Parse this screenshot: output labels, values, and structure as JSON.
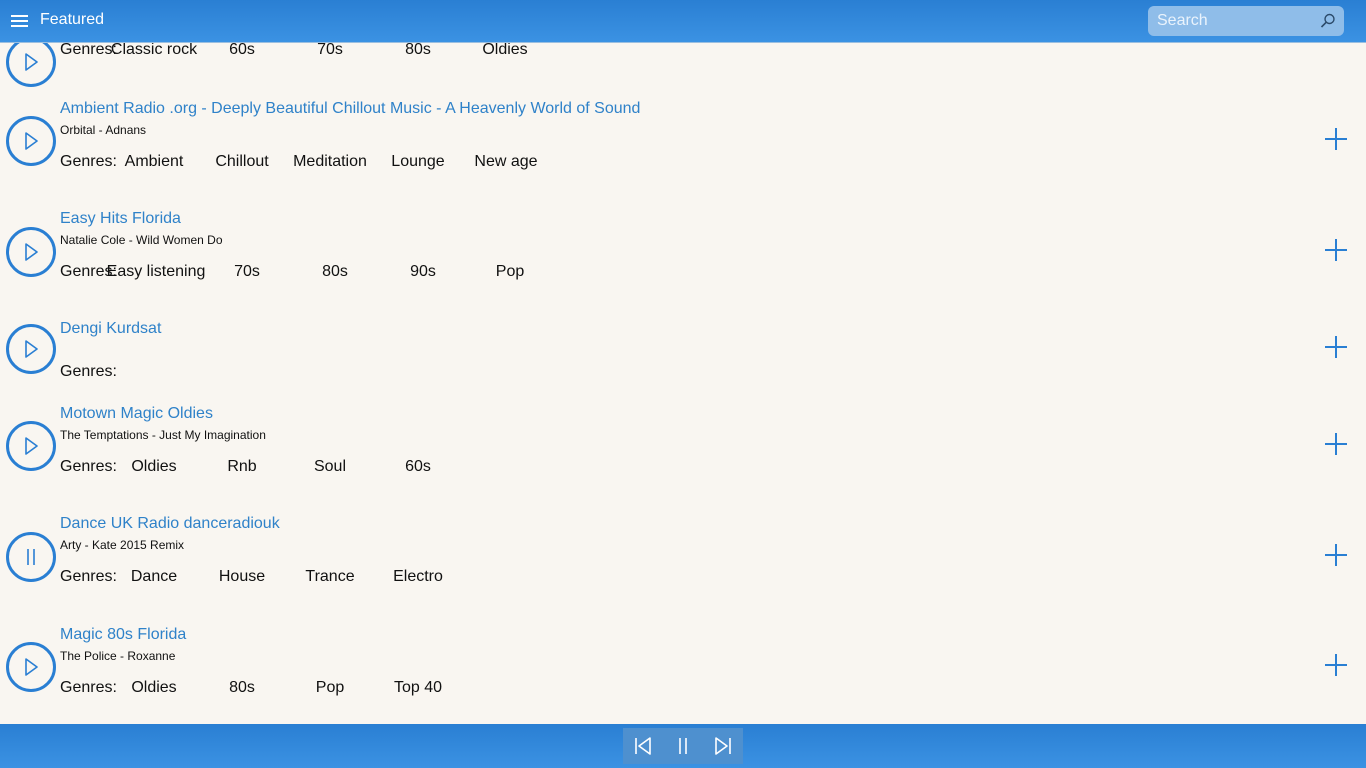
{
  "header": {
    "title": "Featured",
    "search_placeholder": "Search",
    "menu_icon": "hamburger-icon",
    "search_icon": "search-icon"
  },
  "genres_label": "Genres:",
  "stations": [
    {
      "name": "",
      "now_playing": "",
      "state": "play",
      "genres": [
        "Classic rock",
        "60s",
        "70s",
        "80s",
        "Oldies"
      ]
    },
    {
      "name": "Ambient Radio .org - Deeply Beautiful Chillout Music - A Heavenly World of Sound",
      "now_playing": "Orbital - Adnans",
      "state": "play",
      "genres": [
        "Ambient",
        "Chillout",
        "Meditation",
        "Lounge",
        "New age"
      ]
    },
    {
      "name": "Easy Hits Florida",
      "now_playing": "Natalie Cole - Wild Women Do",
      "state": "play",
      "genres": [
        "Easy listening",
        "70s",
        "80s",
        "90s",
        "Pop"
      ]
    },
    {
      "name": "Dengi Kurdsat",
      "now_playing": "",
      "state": "play",
      "genres": []
    },
    {
      "name": "Motown Magic Oldies",
      "now_playing": "The Temptations - Just My Imagination",
      "state": "play",
      "genres": [
        "Oldies",
        "Rnb",
        "Soul",
        "60s"
      ]
    },
    {
      "name": "Dance UK Radio danceradiouk",
      "now_playing": "Arty - Kate 2015 Remix",
      "state": "pause",
      "genres": [
        "Dance",
        "House",
        "Trance",
        "Electro"
      ]
    },
    {
      "name": "Magic 80s Florida",
      "now_playing": "The Police - Roxanne",
      "state": "play",
      "genres": [
        "Oldies",
        "80s",
        "Pop",
        "Top 40"
      ]
    }
  ],
  "player": {
    "controls": [
      "skip-previous-icon",
      "pause-icon",
      "skip-next-icon"
    ]
  },
  "colors": {
    "accent": "#2a7fd3",
    "link": "#2f82c9",
    "background": "#f9f6f1"
  }
}
